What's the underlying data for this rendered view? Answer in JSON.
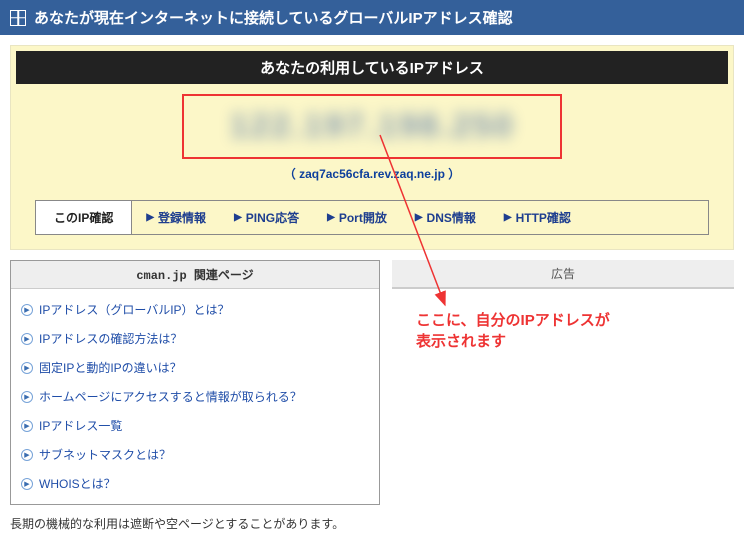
{
  "header": {
    "title": "あなたが現在インターネットに接続しているグローバルIPアドレス確認"
  },
  "panel": {
    "sub_title": "あなたの利用しているIPアドレス",
    "ip_placeholder": "122.197.198.250",
    "hostname": "（ zaq7ac56cfa.rev.zaq.ne.jp ）",
    "tabs": {
      "current": "このIP確認",
      "items": [
        "登録情報",
        "PING応答",
        "Port開放",
        "DNS情報",
        "HTTP確認"
      ]
    }
  },
  "related": {
    "header": "cman.jp 関連ページ",
    "items": [
      "IPアドレス（グローバルIP）とは？",
      "IPアドレスの確認方法は？",
      "固定IPと動的IPの違いは？",
      "ホームページにアクセスすると情報が取られる？",
      "IPアドレス一覧",
      "サブネットマスクとは？",
      "WHOISとは？"
    ]
  },
  "ad": {
    "header": "広告"
  },
  "annotation": {
    "line1": "ここに、自分のIPアドレスが",
    "line2": "表示されます"
  },
  "footer": {
    "note": "長期の機械的な利用は遮断や空ページとすることがあります。"
  }
}
